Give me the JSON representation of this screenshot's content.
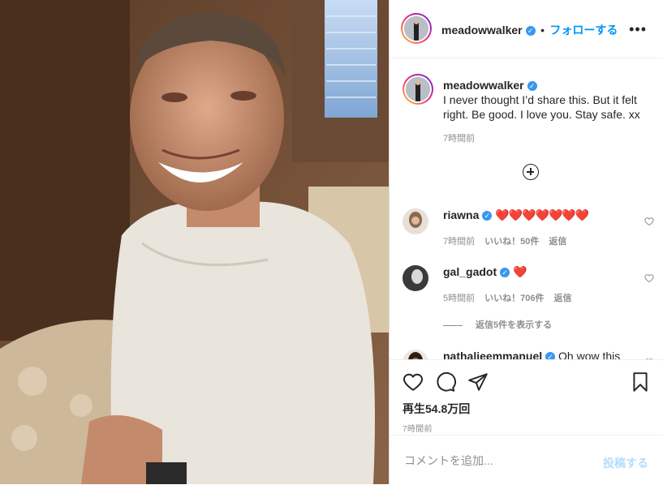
{
  "post": {
    "username": "meadowwalker",
    "follow_separator": "•",
    "follow_label": "フォローする",
    "more_icon": "ellipsis-icon",
    "caption": "I never thought I’d share this. But it felt right. Be good. I love you. Stay safe. xx",
    "caption_time": "7時間前",
    "views": "再生54.8万回",
    "post_time": "7時間前"
  },
  "comments": [
    {
      "username": "riawna",
      "text": "❤️❤️❤️❤️❤️❤️❤️",
      "time": "7時間前",
      "likes": "いいね！50件",
      "reply": "返信"
    },
    {
      "username": "gal_gadot",
      "text": "❤️",
      "time": "5時間前",
      "likes": "いいね！706件",
      "reply": "返信"
    },
    {
      "username": "nathalieemmanuel",
      "text": "Oh wow this",
      "time": "",
      "likes": "",
      "reply": ""
    }
  ],
  "view_replies": "返信5件を表示する",
  "add_comment": {
    "placeholder": "コメントを追加...",
    "post_label": "投稿する"
  },
  "colors": {
    "accent": "#0095f6",
    "verified": "#3897f0",
    "heart": "#ed4956",
    "post_disabled": "#b2dffc"
  }
}
